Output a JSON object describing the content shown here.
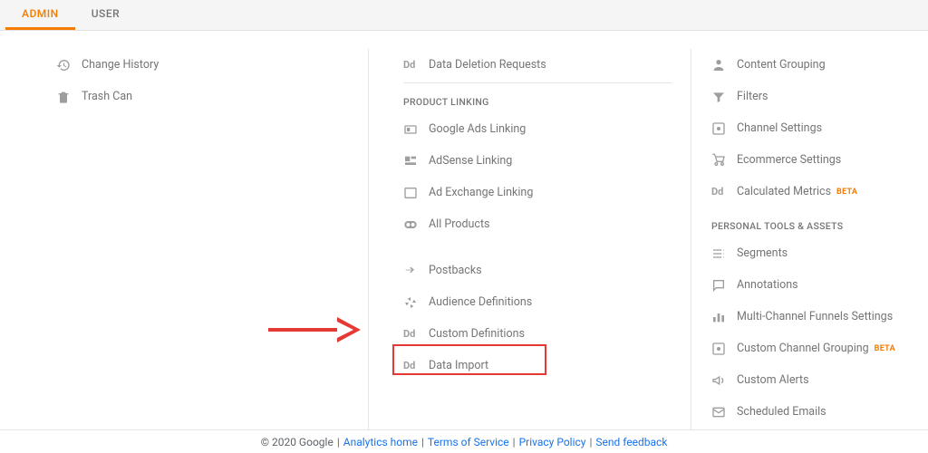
{
  "tabs": {
    "admin": "ADMIN",
    "user": "USER"
  },
  "col1": {
    "items": [
      {
        "label": "Change History"
      },
      {
        "label": "Trash Can"
      }
    ]
  },
  "col2": {
    "data_deletion": "Data Deletion Requests",
    "section_product_linking": "PRODUCT LINKING",
    "google_ads": "Google Ads Linking",
    "adsense": "AdSense Linking",
    "ad_exchange": "Ad Exchange Linking",
    "all_products": "All Products",
    "postbacks": "Postbacks",
    "audience_def": "Audience Definitions",
    "custom_def": "Custom Definitions",
    "data_import": "Data Import"
  },
  "col3": {
    "content_grouping": "Content Grouping",
    "filters": "Filters",
    "channel_settings": "Channel Settings",
    "ecommerce": "Ecommerce Settings",
    "calc_metrics": "Calculated Metrics",
    "beta": "BETA",
    "section_personal": "PERSONAL TOOLS & ASSETS",
    "segments": "Segments",
    "annotations": "Annotations",
    "multi_channel": "Multi-Channel Funnels Settings",
    "custom_channel": "Custom Channel Grouping",
    "custom_alerts": "Custom Alerts",
    "scheduled_emails": "Scheduled Emails"
  },
  "footer": {
    "copyright": "© 2020 Google",
    "analytics_home": "Analytics home",
    "terms": "Terms of Service",
    "privacy": "Privacy Policy",
    "feedback": "Send feedback"
  }
}
